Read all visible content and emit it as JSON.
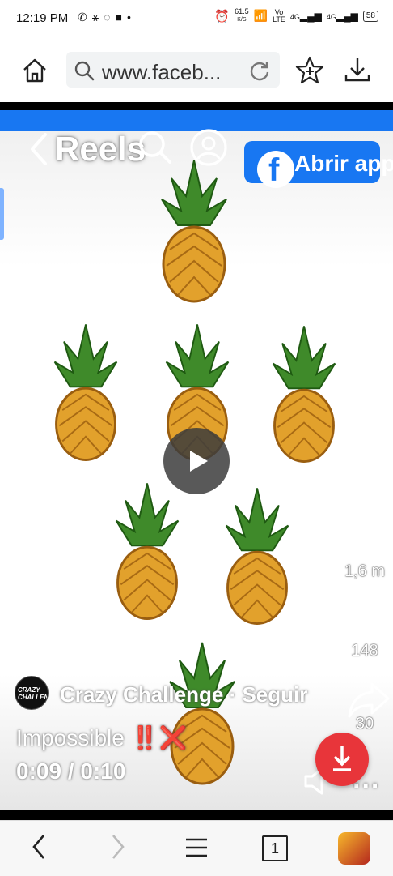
{
  "status_bar": {
    "time": "12:19 PM",
    "speed_value": "61.5",
    "speed_unit": "K/S",
    "volte_top": "Vo",
    "volte_bottom": "LTE",
    "net1": "4G",
    "net2": "4G",
    "battery": "58",
    "left_icons": [
      "whatsapp-icon",
      "toggle-icon",
      "circle-icon",
      "square-icon",
      "dot-icon"
    ],
    "right_icons": [
      "alarm-icon",
      "wifi-icon",
      "signal-icon",
      "signal-icon",
      "battery-icon"
    ]
  },
  "browser": {
    "url": "www.faceb...",
    "icons": [
      "home-icon",
      "search-icon",
      "reload-icon",
      "star-add-icon",
      "download-icon"
    ]
  },
  "reel": {
    "nav_title": "Reels",
    "open_app_label": "Abrir app",
    "author_name": "Crazy Challenge",
    "follow_label": "Seguir",
    "avatar_text": "CRAZY CHALLENGE",
    "description": "Impossible",
    "description_emojis": "‼️❌",
    "current_time": "0:09",
    "time_separator": "/",
    "duration": "0:10",
    "like_count": "1,6 m",
    "comment_count": "148",
    "share_count": "30",
    "more": "..."
  },
  "bottom_nav": {
    "tab_count": "1",
    "icons": [
      "back-icon",
      "forward-icon",
      "menu-icon",
      "tabs-icon",
      "game-app-icon"
    ]
  },
  "colors": {
    "facebook_blue": "#1877f2",
    "fab_red": "#e8353a"
  }
}
